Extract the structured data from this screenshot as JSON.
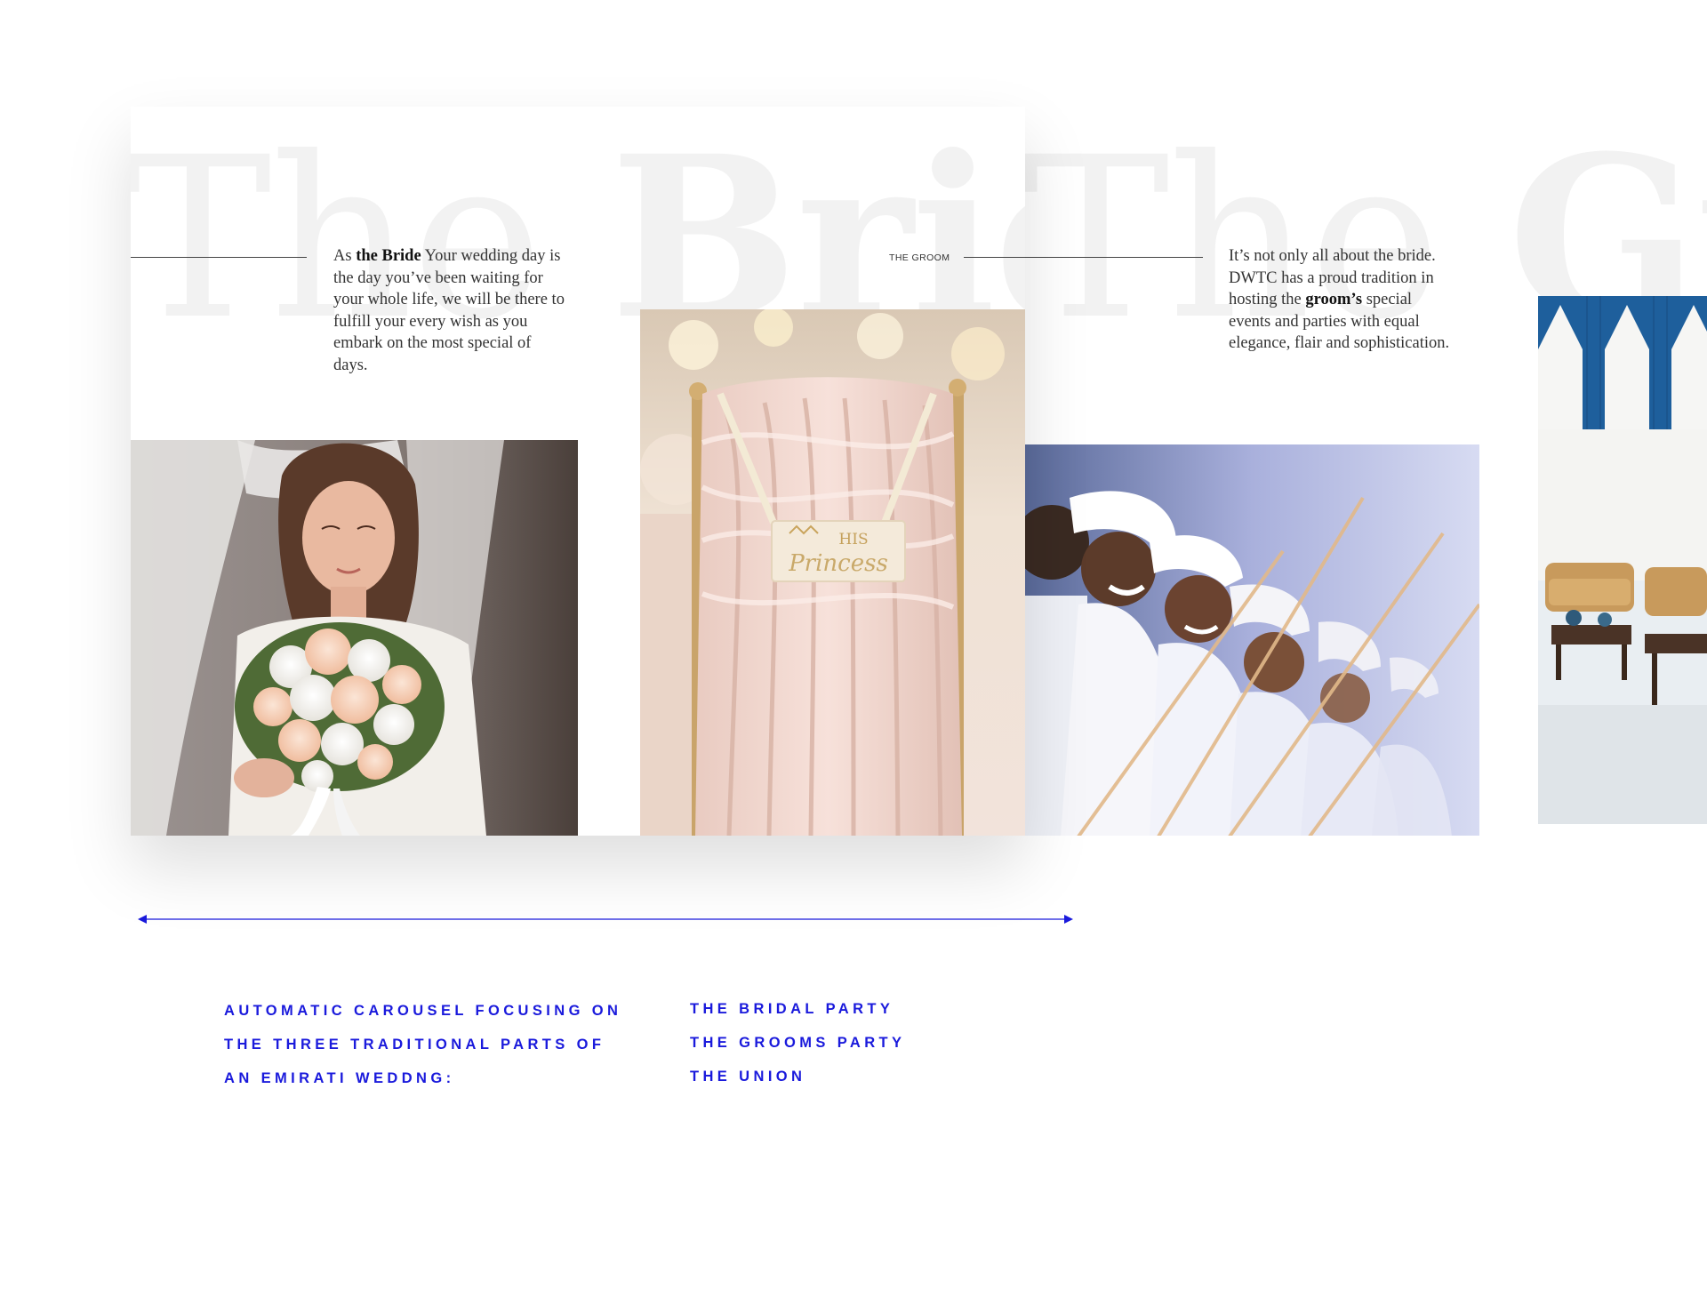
{
  "bride_slide": {
    "title_light": "The ",
    "title_bold": "Bride",
    "intro_prefix": "As ",
    "intro_bold": "the Bride",
    "intro_lines": [
      "Your wedding day is",
      "the day you’ve been waiting for",
      "your whole life, we will be there to",
      "fulfill your every wish as you",
      "embark on the most special of",
      "days."
    ],
    "next_label": "THE GROOM",
    "photo_bouquet": "bride-with-bouquet-photo",
    "photo_chair": "his-princess-chair-photo",
    "chair_sign_top": "HIS",
    "chair_sign_script": "Princess"
  },
  "groom_slide": {
    "title_light": "The ",
    "title_bold": "Groo",
    "intro_lines": [
      "It’s not only all about the bride.",
      "DWTC has a proud tradition in"
    ],
    "intro_line3_prefix": "hosting the ",
    "intro_line3_bold": "groom’s",
    "intro_line3_suffix": " special",
    "intro_lines_after": [
      "events and parties with equal",
      "elegance, flair and sophistication."
    ],
    "photo_men": "groom-party-men-celebrating-photo",
    "photo_majlis": "majlis-hall-photo"
  },
  "annotation": {
    "description_lines": [
      "Automatic carousel focusing on",
      "the three traditional parts of",
      "an Emirati weddng:"
    ],
    "parts": [
      "The bridal party",
      "The grooms party",
      "The union"
    ]
  },
  "colors": {
    "accent_blue": "#1a1adc",
    "title_ghost": "#f2f2f2",
    "body_text": "#333333"
  }
}
